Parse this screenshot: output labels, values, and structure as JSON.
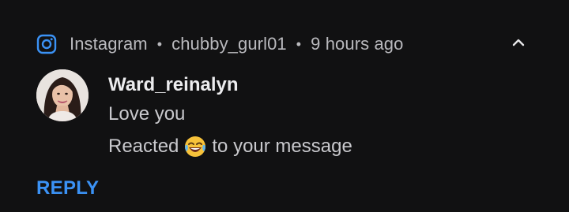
{
  "header": {
    "app_name": "Instagram",
    "account": "chubby_gurl01",
    "time": "9 hours ago",
    "separator": "•",
    "app_icon": "instagram-icon",
    "expand_icon": "chevron-up-icon"
  },
  "message": {
    "sender": "Ward_reinalyn",
    "line1": "Love you",
    "line2_prefix": "Reacted",
    "line2_emoji": "😂",
    "line2_suffix": "to your message"
  },
  "actions": {
    "reply_label": "REPLY"
  },
  "colors": {
    "background": "#111112",
    "accent": "#3b92f5",
    "text_primary": "#ececee",
    "text_secondary": "#b9b9bd"
  }
}
